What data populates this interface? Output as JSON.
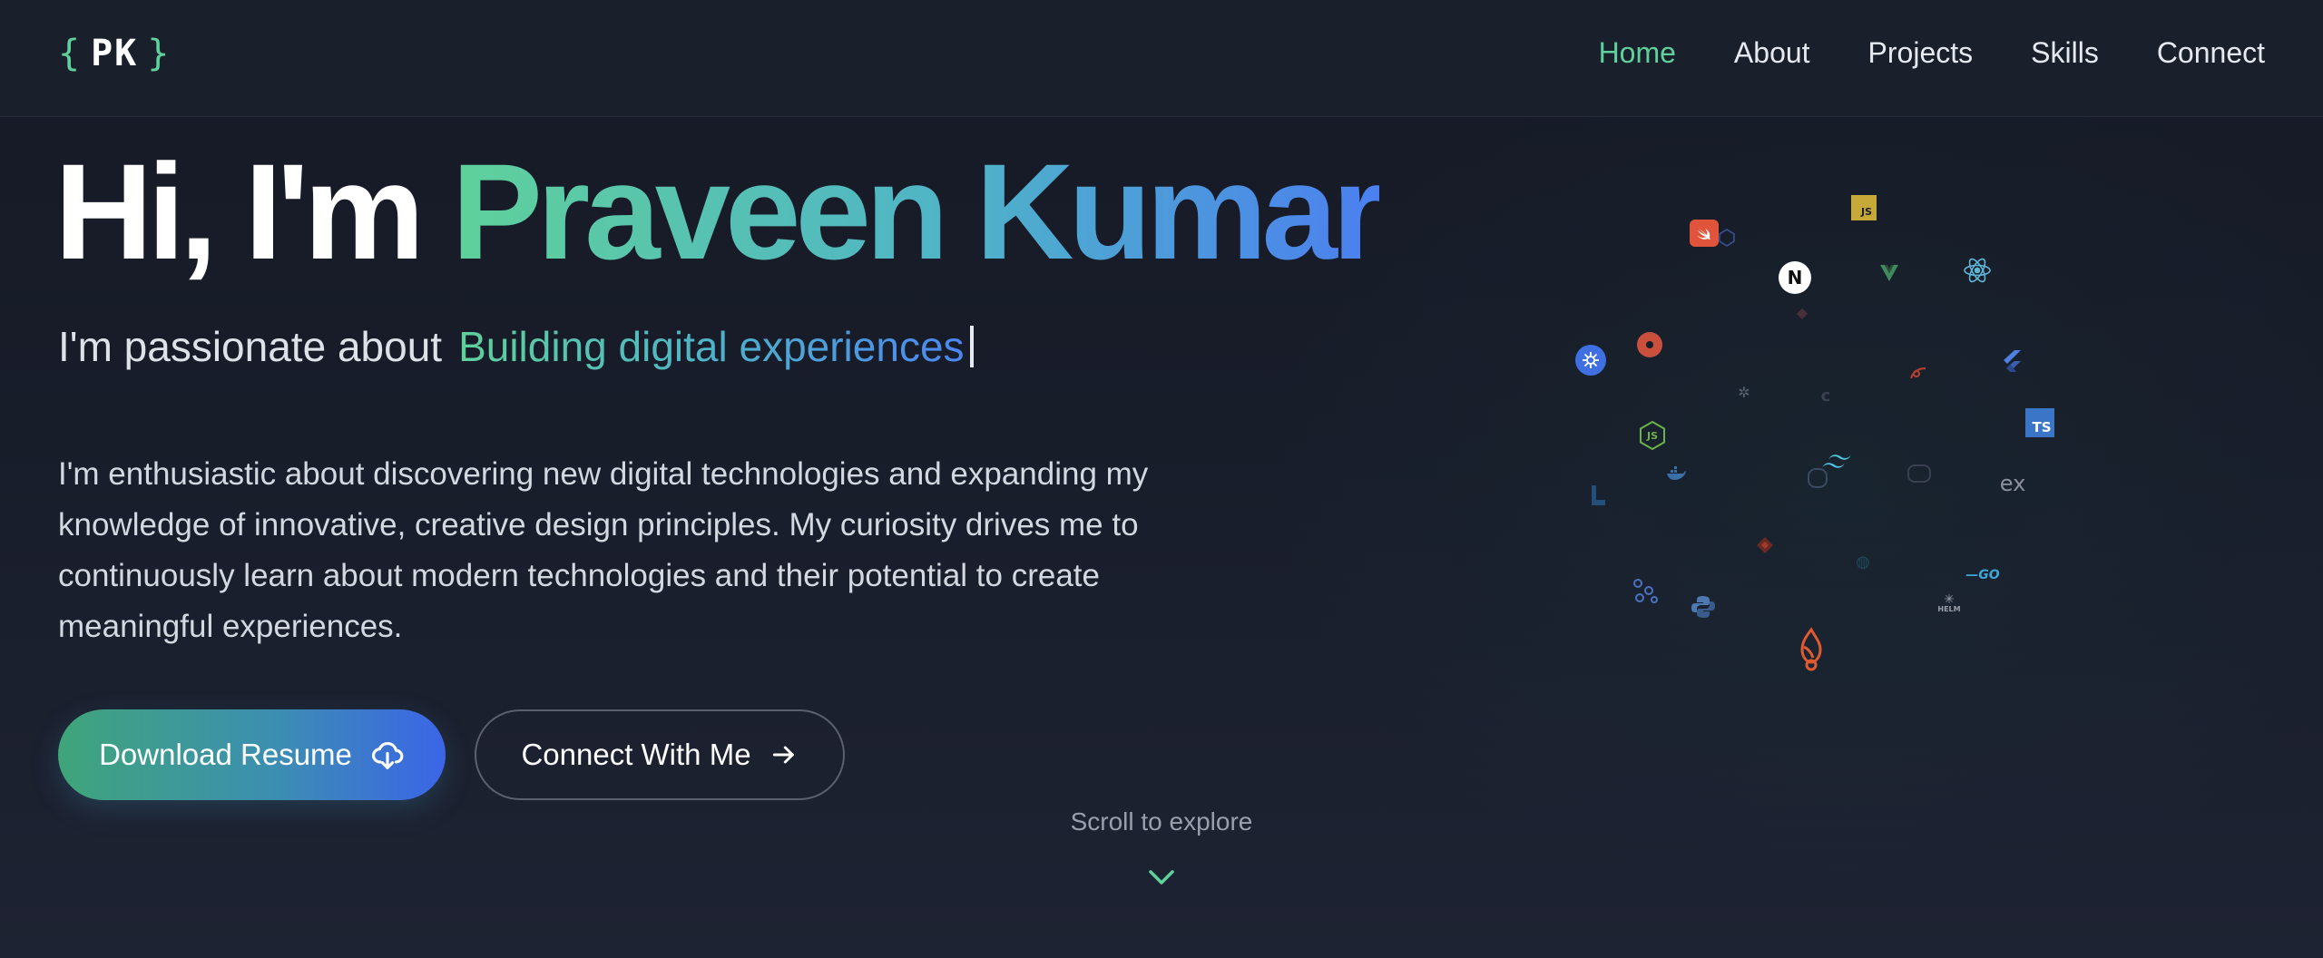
{
  "nav": {
    "logo": {
      "open": "{",
      "initials": "PK",
      "close": "}"
    },
    "links": [
      {
        "label": "Home",
        "active": true
      },
      {
        "label": "About",
        "active": false
      },
      {
        "label": "Projects",
        "active": false
      },
      {
        "label": "Skills",
        "active": false
      },
      {
        "label": "Connect",
        "active": false
      }
    ]
  },
  "hero": {
    "greeting": "Hi, I'm",
    "name": "Praveen Kumar",
    "tagline_prefix": "I'm passionate about",
    "tagline_typed": "Building digital experiences",
    "intro": "I'm enthusiastic about discovering new digital technologies and expanding my knowledge of innovative, creative design principles. My curiosity drives me to continuously learn about modern technologies and their potential to create meaningful experiences.",
    "buttons": {
      "resume": {
        "label": "Download Resume",
        "icon": "cloud-download-icon"
      },
      "connect": {
        "label": "Connect With Me",
        "icon": "arrow-right-icon"
      }
    },
    "scroll_hint": "Scroll to explore"
  },
  "tech_cloud": {
    "icons": [
      {
        "name": "javascript-icon",
        "text": "JS",
        "color": "#c7a93a"
      },
      {
        "name": "swift-icon",
        "text": "",
        "color": "#e0543c"
      },
      {
        "name": "nextjs-icon",
        "text": "N",
        "color": "#ffffff"
      },
      {
        "name": "react-icon",
        "text": "",
        "color": "#61b6d8"
      },
      {
        "name": "kubernetes-icon",
        "text": "",
        "color": "#3f6fe0"
      },
      {
        "name": "redis-icon",
        "text": "",
        "color": "#c8503c"
      },
      {
        "name": "nodejs-icon",
        "text": "JS",
        "color": "#6bb34a"
      },
      {
        "name": "typescript-icon",
        "text": "TS",
        "color": "#3a75c8"
      },
      {
        "name": "flutter-icon",
        "text": "",
        "color": "#4f7fe0"
      },
      {
        "name": "tailwind-icon",
        "text": "",
        "color": "#4fc3e0"
      },
      {
        "name": "express-icon",
        "text": "ex",
        "color": "#8a909c"
      },
      {
        "name": "go-icon",
        "text": "GO",
        "color": "#3fa7d8"
      },
      {
        "name": "helm-icon",
        "text": "HELM",
        "color": "#9aa0aa"
      },
      {
        "name": "python-icon",
        "text": "",
        "color": "#4d78b0"
      },
      {
        "name": "git-icon",
        "text": "",
        "color": "#c24a30"
      },
      {
        "name": "firebase-icon",
        "text": "",
        "color": "#e05a30"
      },
      {
        "name": "docker-icon",
        "text": "",
        "color": "#3a6fa8"
      },
      {
        "name": "vue-icon",
        "text": "",
        "color": "#3f8a5a"
      },
      {
        "name": "graphql-icon",
        "text": "",
        "color": "#3a6fd0"
      }
    ]
  }
}
